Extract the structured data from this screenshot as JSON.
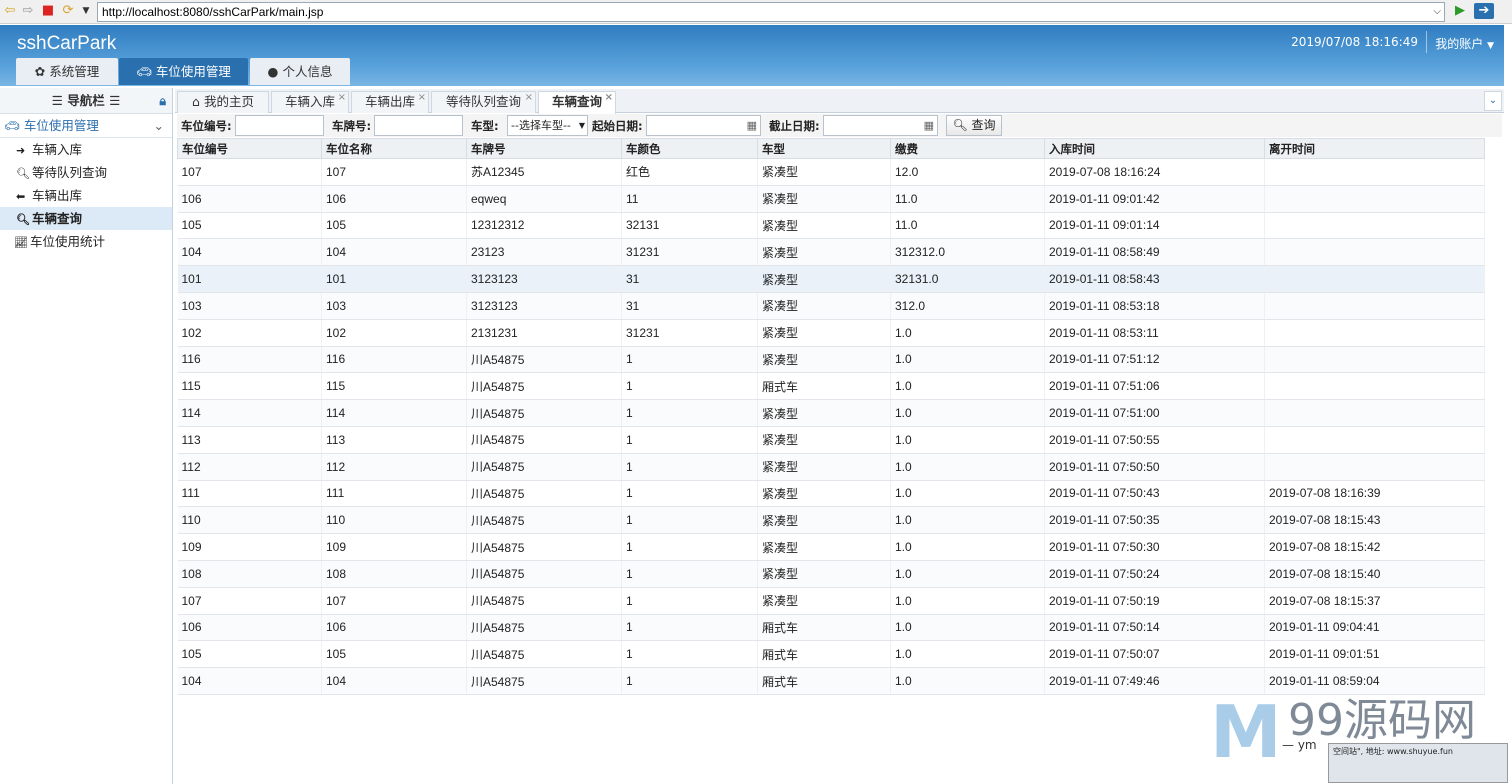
{
  "browser": {
    "url": "http://localhost:8080/sshCarPark/main.jsp"
  },
  "header": {
    "app_title": "sshCarPark",
    "datetime": "2019/07/08 18:16:49",
    "account_label": "我的账户",
    "tabs": [
      {
        "label": "系统管理",
        "icon": "gear-icon"
      },
      {
        "label": "车位使用管理",
        "icon": "car-icon"
      },
      {
        "label": "个人信息",
        "icon": "user-icon"
      }
    ]
  },
  "sidebar": {
    "title": "导航栏",
    "group": "车位使用管理",
    "items": [
      {
        "label": "车辆入库",
        "icon": "arrow-circle-right-icon"
      },
      {
        "label": "等待队列查询",
        "icon": "search-icon"
      },
      {
        "label": "车辆出库",
        "icon": "arrow-circle-left-icon"
      },
      {
        "label": "车辆查询",
        "icon": "search-icon"
      },
      {
        "label": "车位使用统计",
        "icon": "line-chart-icon"
      }
    ]
  },
  "tabs": [
    {
      "label": "我的主页"
    },
    {
      "label": "车辆入库"
    },
    {
      "label": "车辆出库"
    },
    {
      "label": "等待队列查询"
    },
    {
      "label": "车辆查询"
    }
  ],
  "search": {
    "space_no_label": "车位编号:",
    "plate_label": "车牌号:",
    "type_label": "车型:",
    "type_value": "--选择车型--",
    "start_label": "起始日期:",
    "end_label": "截止日期:",
    "button": "查询"
  },
  "table": {
    "headers": [
      "车位编号",
      "车位名称",
      "车牌号",
      "车颜色",
      "车型",
      "缴费",
      "入库时间",
      "离开时间"
    ],
    "rows": [
      [
        "107",
        "107",
        "苏A12345",
        "红色",
        "紧凑型",
        "12.0",
        "2019-07-08 18:16:24",
        ""
      ],
      [
        "106",
        "106",
        "eqweq",
        "11",
        "紧凑型",
        "11.0",
        "2019-01-11 09:01:42",
        ""
      ],
      [
        "105",
        "105",
        "12312312",
        "32131",
        "紧凑型",
        "11.0",
        "2019-01-11 09:01:14",
        ""
      ],
      [
        "104",
        "104",
        "23123",
        "31231",
        "紧凑型",
        "312312.0",
        "2019-01-11 08:58:49",
        ""
      ],
      [
        "101",
        "101",
        "3123123",
        "31",
        "紧凑型",
        "32131.0",
        "2019-01-11 08:58:43",
        ""
      ],
      [
        "103",
        "103",
        "3123123",
        "31",
        "紧凑型",
        "312.0",
        "2019-01-11 08:53:18",
        ""
      ],
      [
        "102",
        "102",
        "2131231",
        "31231",
        "紧凑型",
        "1.0",
        "2019-01-11 08:53:11",
        ""
      ],
      [
        "116",
        "116",
        "川A54875",
        "1",
        "紧凑型",
        "1.0",
        "2019-01-11 07:51:12",
        ""
      ],
      [
        "115",
        "115",
        "川A54875",
        "1",
        "厢式车",
        "1.0",
        "2019-01-11 07:51:06",
        ""
      ],
      [
        "114",
        "114",
        "川A54875",
        "1",
        "紧凑型",
        "1.0",
        "2019-01-11 07:51:00",
        ""
      ],
      [
        "113",
        "113",
        "川A54875",
        "1",
        "紧凑型",
        "1.0",
        "2019-01-11 07:50:55",
        ""
      ],
      [
        "112",
        "112",
        "川A54875",
        "1",
        "紧凑型",
        "1.0",
        "2019-01-11 07:50:50",
        ""
      ],
      [
        "111",
        "111",
        "川A54875",
        "1",
        "紧凑型",
        "1.0",
        "2019-01-11 07:50:43",
        "2019-07-08 18:16:39"
      ],
      [
        "110",
        "110",
        "川A54875",
        "1",
        "紧凑型",
        "1.0",
        "2019-01-11 07:50:35",
        "2019-07-08 18:15:43"
      ],
      [
        "109",
        "109",
        "川A54875",
        "1",
        "紧凑型",
        "1.0",
        "2019-01-11 07:50:30",
        "2019-07-08 18:15:42"
      ],
      [
        "108",
        "108",
        "川A54875",
        "1",
        "紧凑型",
        "1.0",
        "2019-01-11 07:50:24",
        "2019-07-08 18:15:40"
      ],
      [
        "107",
        "107",
        "川A54875",
        "1",
        "紧凑型",
        "1.0",
        "2019-01-11 07:50:19",
        "2019-07-08 18:15:37"
      ],
      [
        "106",
        "106",
        "川A54875",
        "1",
        "厢式车",
        "1.0",
        "2019-01-11 07:50:14",
        "2019-01-11 09:04:41"
      ],
      [
        "105",
        "105",
        "川A54875",
        "1",
        "厢式车",
        "1.0",
        "2019-01-11 07:50:07",
        "2019-01-11 09:01:51"
      ],
      [
        "104",
        "104",
        "川A54875",
        "1",
        "厢式车",
        "1.0",
        "2019-01-11 07:49:46",
        "2019-01-11 08:59:04"
      ]
    ]
  },
  "watermark": {
    "text": "99源码网",
    "sub": "— ym",
    "box": "空间站\", 地址: www.shuyue.fun"
  }
}
